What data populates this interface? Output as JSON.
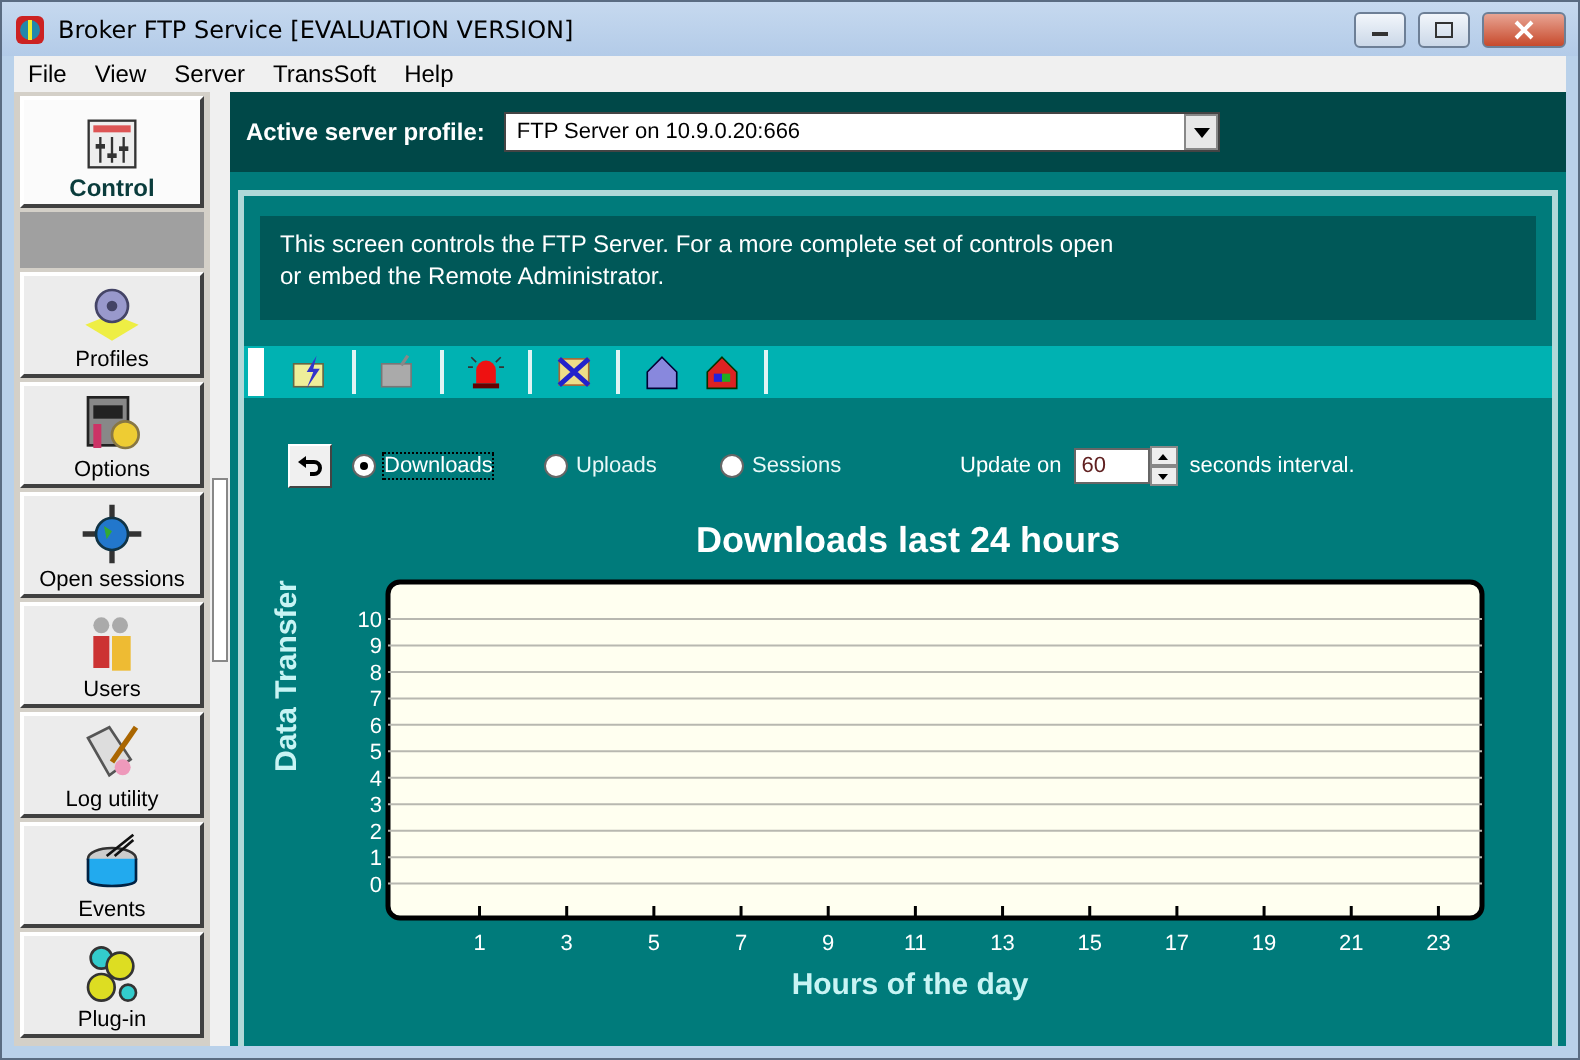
{
  "window": {
    "title": "Broker FTP Service [EVALUATION VERSION]"
  },
  "menu": [
    "File",
    "View",
    "Server",
    "TransSoft",
    "Help"
  ],
  "sidebar": {
    "items": [
      {
        "label": "Control",
        "selected": true
      },
      {
        "label": "Profiles",
        "selected": false
      },
      {
        "label": "Options",
        "selected": false
      },
      {
        "label": "Open sessions",
        "selected": false
      },
      {
        "label": "Users",
        "selected": false
      },
      {
        "label": "Log utility",
        "selected": false
      },
      {
        "label": "Events",
        "selected": false
      },
      {
        "label": "Plug-in",
        "selected": false
      }
    ]
  },
  "profile": {
    "label": "Active server profile:",
    "value": "FTP Server on 10.9.0.20:666"
  },
  "info": "This screen controls the FTP Server. For a more complete set of controls open or embed the Remote Administrator.",
  "view_options": [
    {
      "label": "Downloads",
      "selected": true
    },
    {
      "label": "Uploads",
      "selected": false
    },
    {
      "label": "Sessions",
      "selected": false
    }
  ],
  "update": {
    "label": "Update on",
    "value": "60",
    "suffix": "seconds interval."
  },
  "chart": {
    "chart_data": {
      "type": "line",
      "title": "Downloads last 24 hours",
      "xlabel": "Hours of the day",
      "ylabel": "Data Transfer",
      "xlim": [
        -1.1,
        24
      ],
      "ylim": [
        -1.3,
        11.4
      ],
      "grid": true,
      "xticks": [
        1,
        3,
        5,
        7,
        9,
        11,
        13,
        15,
        17,
        19,
        21,
        23
      ],
      "yticks": [
        0,
        1,
        2,
        3,
        4,
        5,
        6,
        7,
        8,
        9,
        10
      ]
    }
  }
}
